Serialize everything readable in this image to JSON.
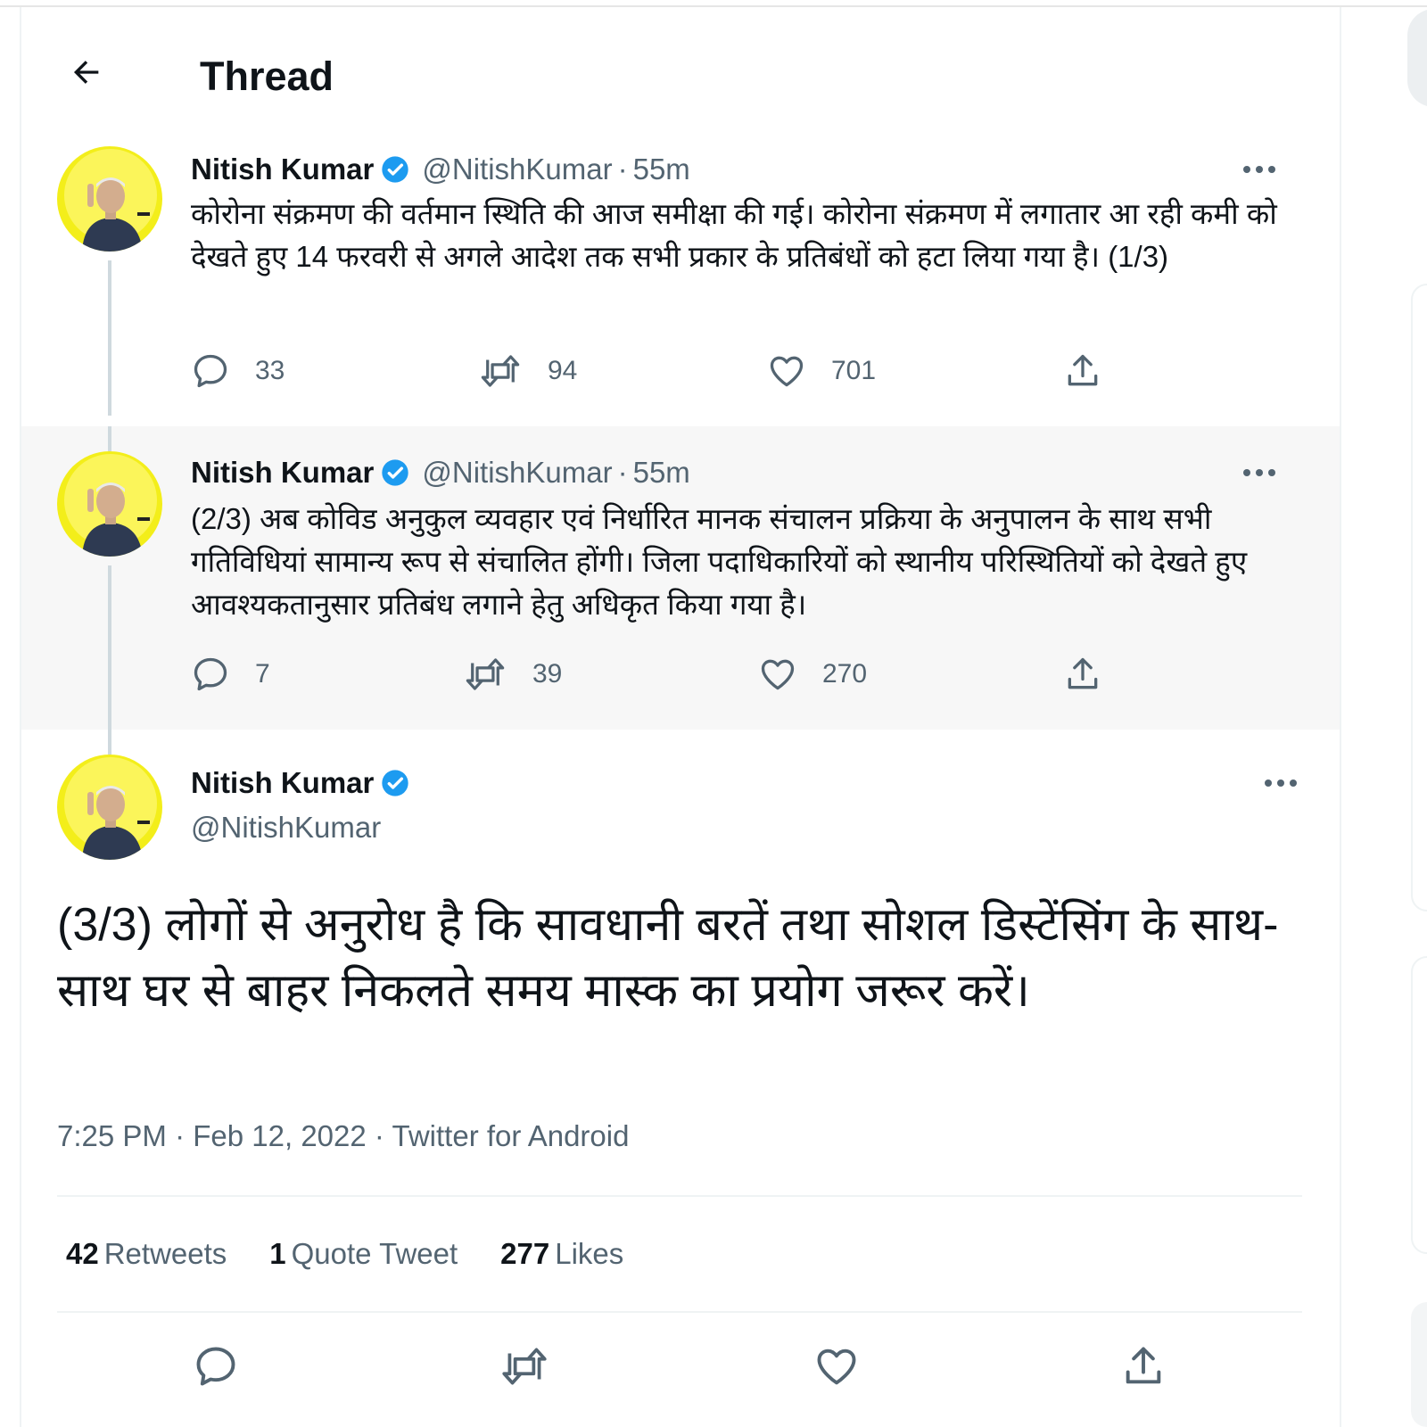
{
  "header": {
    "title": "Thread"
  },
  "tweets": [
    {
      "name": "Nitish Kumar",
      "handle": "@NitishKumar",
      "dot": "·",
      "time": "55m",
      "text": "कोरोना संक्रमण की वर्तमान स्थिति की आज समीक्षा की गई। कोरोना संक्रमण में लगातार आ रही कमी को देखते हुए 14 फरवरी से अगले आदेश तक सभी प्रकार के प्रतिबंधों को हटा लिया गया है। (1/3)",
      "replies": "33",
      "retweets": "94",
      "likes": "701"
    },
    {
      "name": "Nitish Kumar",
      "handle": "@NitishKumar",
      "dot": "·",
      "time": "55m",
      "text": "(2/3) अब कोविड अनुकुल व्यवहार एवं निर्धारित मानक संचालन प्रक्रिया के अनुपालन के साथ सभी गतिविधियां सामान्य रूप से संचालित होंगी। जिला पदाधिकारियों को स्थानीय परिस्थितियों को देखते हुए आवश्यकतानुसार प्रतिबंध लगाने हेतु अधिकृत किया गया है।",
      "replies": "7",
      "retweets": "39",
      "likes": "270"
    }
  ],
  "main_tweet": {
    "name": "Nitish Kumar",
    "handle": "@NitishKumar",
    "text": "(3/3) लोगों से अनुरोध है कि सावधानी बरतें तथा सोशल डिस्टेंसिंग के साथ-साथ घर से बाहर निकलते समय मास्क का प्रयोग जरूर करें।",
    "time": "7:25 PM",
    "dot": "·",
    "date": "Feb 12, 2022",
    "source": "Twitter for Android",
    "stats": {
      "retweets_count": "42",
      "retweets_label": "Retweets",
      "quotes_count": "1",
      "quotes_label": "Quote Tweet",
      "likes_count": "277",
      "likes_label": "Likes"
    }
  },
  "colors": {
    "verified": "#1d9bf0",
    "secondary_text": "#536471",
    "thread_line": "#cfd9de",
    "avatar_bg": "#f3ee1a"
  },
  "icons": [
    "back-arrow-icon",
    "verified-badge-icon",
    "more-icon",
    "reply-icon",
    "retweet-icon",
    "like-icon",
    "share-icon"
  ]
}
